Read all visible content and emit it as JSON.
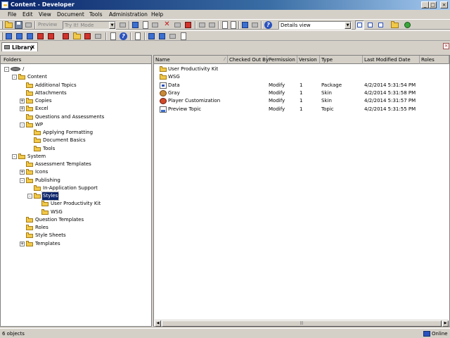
{
  "window": {
    "title": "Content - Developer"
  },
  "menu": [
    "File",
    "Edit",
    "View",
    "Document",
    "Tools",
    "Administration",
    "Help"
  ],
  "toolbar": {
    "preview_label": "Preview",
    "mode_value": "Try It! Mode",
    "view_value": "Details view"
  },
  "tab": {
    "label": "Library",
    "close": "x"
  },
  "folders_header": "Folders",
  "tree": [
    {
      "label": "/",
      "level": 0
    },
    {
      "label": "Content",
      "level": 1
    },
    {
      "label": "Additional Topics",
      "level": 2
    },
    {
      "label": "Attachments",
      "level": 2
    },
    {
      "label": "Copies",
      "level": 2
    },
    {
      "label": "Excel",
      "level": 2
    },
    {
      "label": "Questions and Assessments",
      "level": 2
    },
    {
      "label": "WP",
      "level": 2
    },
    {
      "label": "Applying Formatting",
      "level": 3
    },
    {
      "label": "Document Basics",
      "level": 3
    },
    {
      "label": "Tools",
      "level": 3
    },
    {
      "label": "System",
      "level": 1
    },
    {
      "label": "Assessment Templates",
      "level": 2
    },
    {
      "label": "Icons",
      "level": 2
    },
    {
      "label": "Publishing",
      "level": 2
    },
    {
      "label": "In-Application Support",
      "level": 3
    },
    {
      "label": "Styles",
      "level": 3
    },
    {
      "label": "User Productivity Kit",
      "level": 4
    },
    {
      "label": "WSG",
      "level": 4
    },
    {
      "label": "Question Templates",
      "level": 2
    },
    {
      "label": "Roles",
      "level": 2
    },
    {
      "label": "Style Sheets",
      "level": 2
    },
    {
      "label": "Templates",
      "level": 2
    }
  ],
  "columns": [
    "Name",
    "Checked Out By",
    "Permission",
    "Version",
    "Type",
    "Last Modified Date",
    "Roles"
  ],
  "rows": [
    {
      "name": "User Productivity Kit",
      "checked_out": "",
      "permission": "",
      "version": "",
      "type": "",
      "modified": "",
      "icon": "folder-icon"
    },
    {
      "name": "WSG",
      "checked_out": "",
      "permission": "",
      "version": "",
      "type": "",
      "modified": "",
      "icon": "folder-icon"
    },
    {
      "name": "Data",
      "checked_out": "",
      "permission": "Modify",
      "version": "1",
      "type": "Package",
      "modified": "4/2/2014 5:31:54 PM",
      "icon": "package-icon"
    },
    {
      "name": "Gray",
      "checked_out": "",
      "permission": "Modify",
      "version": "1",
      "type": "Skin",
      "modified": "4/2/2014 5:31:58 PM",
      "icon": "skin-icon"
    },
    {
      "name": "Player Customization",
      "checked_out": "",
      "permission": "Modify",
      "version": "1",
      "type": "Skin",
      "modified": "4/2/2014 5:31:57 PM",
      "icon": "skin-icon"
    },
    {
      "name": "Preview Topic",
      "checked_out": "",
      "permission": "Modify",
      "version": "1",
      "type": "Topic",
      "modified": "4/2/2014 5:31:55 PM",
      "icon": "topic-icon"
    }
  ],
  "status": {
    "count": "6 objects",
    "mode": "Online"
  }
}
